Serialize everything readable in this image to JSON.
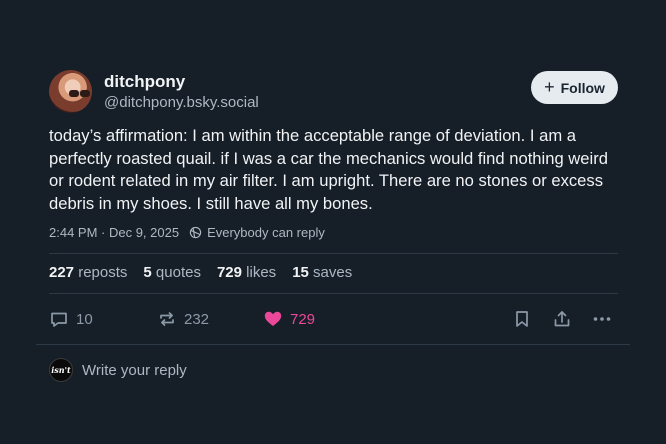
{
  "author": {
    "display_name": "ditchpony",
    "handle": "@ditchpony.bsky.social"
  },
  "follow_label": "Follow",
  "post": {
    "text": "today’s affirmation: I am within the acceptable range of deviation. I am a perfectly roasted quail. if I was a car the mechanics would find nothing weird or rodent related in my air filter. I am upright. There are no stones or excess debris in my shoes. I still have all my bones.",
    "timestamp": "2:44 PM · Dec 9, 2025",
    "reply_setting": "Everybody can reply"
  },
  "stats": {
    "reposts_count": "227",
    "reposts_label": "reposts",
    "quotes_count": "5",
    "quotes_label": "quotes",
    "likes_count": "729",
    "likes_label": "likes",
    "saves_count": "15",
    "saves_label": "saves"
  },
  "actions": {
    "replies": "10",
    "reposts": "232",
    "likes": "729"
  },
  "reply_box": {
    "avatar_text": "isn't",
    "placeholder": "Write your reply"
  },
  "colors": {
    "background": "#161e27",
    "like_accent": "#ec4899",
    "muted_text": "#aeb8c4"
  }
}
